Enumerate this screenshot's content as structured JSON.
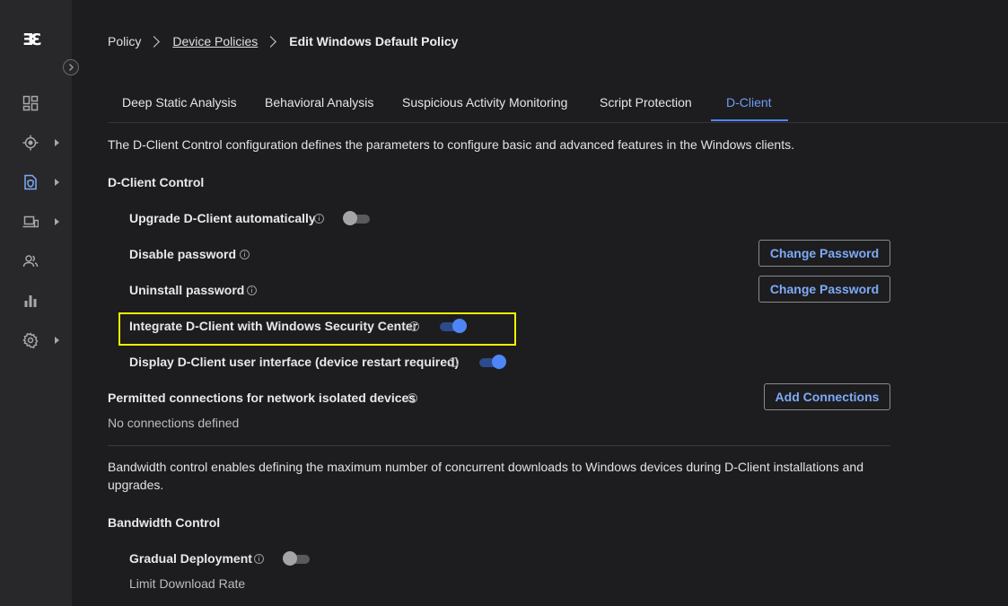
{
  "sidebar": {
    "logo": "ƎƐ",
    "items": [
      {
        "icon": "dashboard-icon"
      },
      {
        "icon": "target-icon",
        "has_submenu": true
      },
      {
        "icon": "policy-shield-icon",
        "has_submenu": true,
        "active": true
      },
      {
        "icon": "devices-icon",
        "has_submenu": true
      },
      {
        "icon": "users-icon"
      },
      {
        "icon": "reports-chart-icon"
      },
      {
        "icon": "settings-gear-icon",
        "has_submenu": true
      }
    ]
  },
  "breadcrumb": {
    "root": "Policy",
    "parent": "Device Policies",
    "current": "Edit Windows Default Policy"
  },
  "tabs": [
    {
      "label": "Deep Static Analysis"
    },
    {
      "label": "Behavioral Analysis"
    },
    {
      "label": "Suspicious Activity Monitoring"
    },
    {
      "label": "Script Protection"
    },
    {
      "label": "D-Client",
      "active": true
    }
  ],
  "content": {
    "intro": "The D-Client Control configuration defines the parameters to configure basic and advanced features in the Windows clients.",
    "dclient_control_title": "D-Client Control",
    "settings": [
      {
        "label": "Upgrade D-Client automatically",
        "type": "toggle",
        "value": false
      },
      {
        "label": "Disable password",
        "type": "button",
        "button_label": "Change Password"
      },
      {
        "label": "Uninstall password",
        "type": "button",
        "button_label": "Change Password"
      },
      {
        "label": "Integrate D-Client with Windows Security Center",
        "type": "toggle",
        "value": true
      },
      {
        "label": "Display D-Client user interface (device restart required)",
        "type": "toggle",
        "value": true
      }
    ],
    "permitted": {
      "label": "Permitted connections for network isolated devices",
      "button_label": "Add Connections",
      "empty_text": "No connections defined"
    },
    "bandwidth_intro_line1": "Bandwidth control enables defining the maximum number of concurrent downloads to Windows devices during D-Client installations and",
    "bandwidth_intro_line2": "upgrades.",
    "bandwidth_title": "Bandwidth Control",
    "gradual": {
      "label": "Gradual Deployment",
      "value": false
    },
    "limit_label": "Limit Download Rate"
  },
  "colors": {
    "accent": "#4f86f7",
    "highlight": "#f4f000",
    "background": "#1d1d1f",
    "sidebar": "#28282a"
  }
}
